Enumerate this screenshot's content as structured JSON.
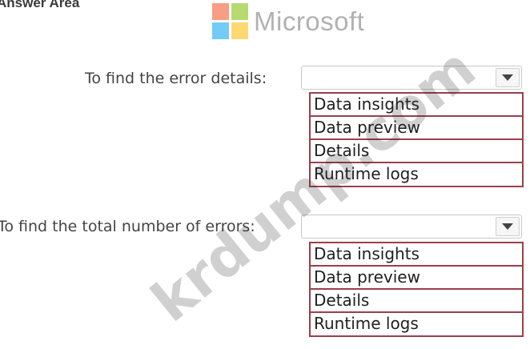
{
  "answer_area": {
    "title": "Answer Area"
  },
  "logo": {
    "text": "Microsoft",
    "colors": [
      "#f25022",
      "#7fba00",
      "#00a4ef",
      "#ffb900"
    ]
  },
  "questions": [
    {
      "prompt": "To find the error details:",
      "selected": "",
      "options": [
        "Data insights",
        "Data preview",
        "Details",
        "Runtime logs"
      ]
    },
    {
      "prompt": "To find the total number of errors:",
      "selected": "",
      "options": [
        "Data insights",
        "Data preview",
        "Details",
        "Runtime logs"
      ]
    }
  ],
  "watermark": {
    "text": "krdump.com"
  },
  "colors": {
    "option_border": "#9b3f4a",
    "text": "#1f1f1f"
  },
  "icons": {
    "dropdown": "chevron-down-icon"
  }
}
